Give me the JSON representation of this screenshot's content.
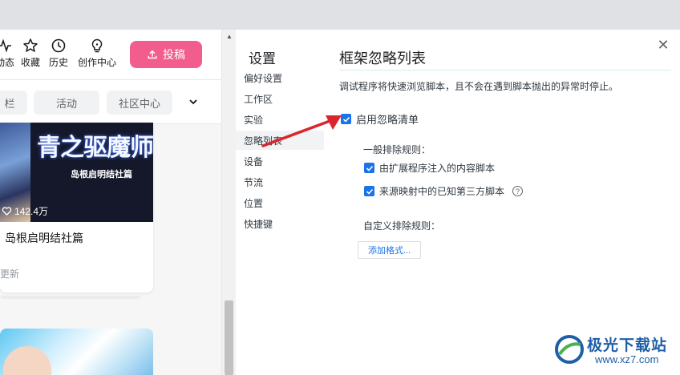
{
  "site": {
    "nav_items": [
      {
        "label": "动态",
        "icon": "activity-icon"
      },
      {
        "label": "收藏",
        "icon": "star-icon"
      },
      {
        "label": "历史",
        "icon": "clock-icon"
      },
      {
        "label": "创作中心",
        "icon": "lightbulb-icon"
      }
    ],
    "upload_label": "投稿",
    "tags": [
      "栏",
      "活动",
      "社区中心"
    ],
    "card": {
      "cover_title": "青之驱魔师",
      "cover_subtitle": "岛根启明结社篇",
      "likes": "142.4万",
      "title": "岛根启明结社篇",
      "meta": "更新"
    }
  },
  "settings": {
    "sidebar_title": "设置",
    "sidebar_items": [
      "偏好设置",
      "工作区",
      "实验",
      "忽略列表",
      "设备",
      "节流",
      "位置",
      "快捷键"
    ],
    "active_index": 3,
    "pane_title": "框架忽略列表",
    "description": "调试程序将快速浏览脚本，且不会在遇到脚本抛出的异常时停止。",
    "enable_label": "启用忽略清单",
    "general_rules_label": "一般排除规则：",
    "rule_1": "由扩展程序注入的内容脚本",
    "rule_2": "来源映射中的已知第三方脚本",
    "custom_rules_label": "自定义排除规则：",
    "add_pattern_label": "添加格式...",
    "close_icon": "✕",
    "help_icon": "?"
  },
  "watermark": {
    "name": "极光下载站",
    "url": "www.xz7.com"
  },
  "colors": {
    "accent": "#1a73e8",
    "upload": "#f25d8e",
    "arrow": "#d9262c",
    "watermark": "#1e5fa8"
  }
}
